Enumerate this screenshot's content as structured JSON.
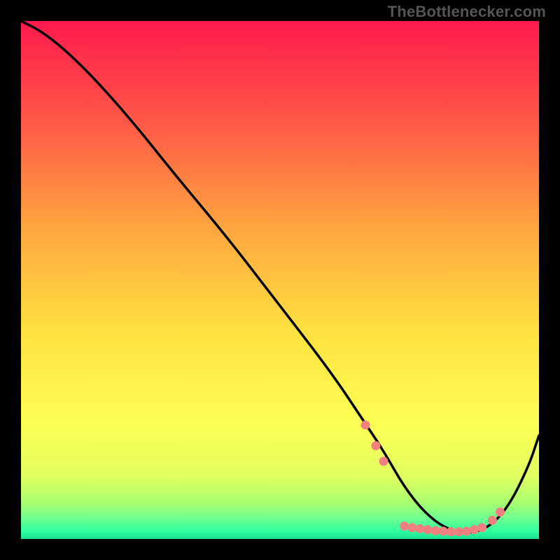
{
  "watermark": "TheBottlenecker.com",
  "chart_data": {
    "type": "line",
    "title": "",
    "xlabel": "",
    "ylabel": "",
    "xlim": [
      0,
      100
    ],
    "ylim": [
      0,
      100
    ],
    "gradient_stops": [
      {
        "offset": 0.0,
        "color": "#ff1a4d"
      },
      {
        "offset": 0.2,
        "color": "#ff5a47"
      },
      {
        "offset": 0.4,
        "color": "#ffa640"
      },
      {
        "offset": 0.6,
        "color": "#ffe140"
      },
      {
        "offset": 0.78,
        "color": "#fdff55"
      },
      {
        "offset": 0.88,
        "color": "#e0ff60"
      },
      {
        "offset": 0.93,
        "color": "#a8ff70"
      },
      {
        "offset": 0.96,
        "color": "#70ff90"
      },
      {
        "offset": 0.985,
        "color": "#30ffa0"
      },
      {
        "offset": 1.0,
        "color": "#18e090"
      }
    ],
    "series": [
      {
        "name": "bottleneck-curve",
        "x": [
          0,
          4,
          9,
          15,
          22,
          30,
          40,
          50,
          60,
          66,
          70,
          74,
          78,
          82,
          86,
          90,
          94,
          98,
          100
        ],
        "values": [
          100,
          98,
          94,
          88,
          80,
          70,
          58,
          45,
          32,
          23,
          17,
          10,
          5,
          2,
          1,
          2,
          6,
          14,
          20
        ]
      }
    ],
    "markers": {
      "name": "optimal-range-dots",
      "color": "#f28080",
      "points": [
        {
          "x": 66.5,
          "y": 22
        },
        {
          "x": 68.5,
          "y": 18
        },
        {
          "x": 70.0,
          "y": 15
        },
        {
          "x": 74.0,
          "y": 2.5
        },
        {
          "x": 75.5,
          "y": 2.2
        },
        {
          "x": 77.0,
          "y": 2.0
        },
        {
          "x": 78.5,
          "y": 1.8
        },
        {
          "x": 80.0,
          "y": 1.6
        },
        {
          "x": 81.5,
          "y": 1.5
        },
        {
          "x": 83.0,
          "y": 1.4
        },
        {
          "x": 84.5,
          "y": 1.4
        },
        {
          "x": 86.0,
          "y": 1.5
        },
        {
          "x": 87.5,
          "y": 1.8
        },
        {
          "x": 89.0,
          "y": 2.2
        },
        {
          "x": 91.0,
          "y": 3.6
        },
        {
          "x": 92.5,
          "y": 5.2
        }
      ]
    }
  }
}
